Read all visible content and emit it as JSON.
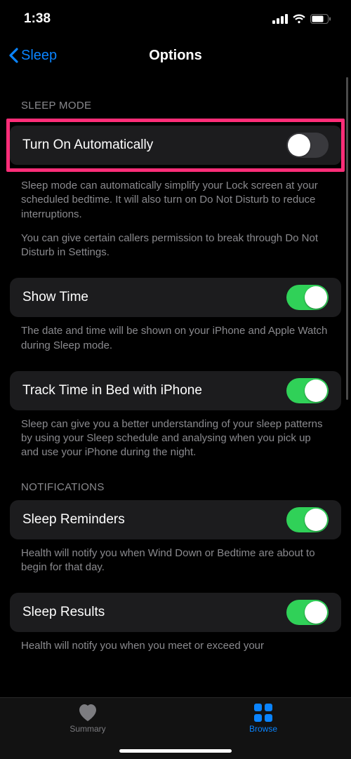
{
  "status": {
    "time": "1:38"
  },
  "nav": {
    "back": "Sleep",
    "title": "Options"
  },
  "sections": {
    "sleep_mode": {
      "header": "SLEEP MODE",
      "turn_on_auto": {
        "label": "Turn On Automatically",
        "on": false
      },
      "desc1": "Sleep mode can automatically simplify your Lock screen at your scheduled bedtime. It will also turn on Do Not Disturb to reduce interruptions.",
      "desc2": "You can give certain callers permission to break through Do Not Disturb in Settings.",
      "show_time": {
        "label": "Show Time",
        "on": true
      },
      "show_time_desc": "The date and time will be shown on your iPhone and Apple Watch during Sleep mode.",
      "track": {
        "label": "Track Time in Bed with iPhone",
        "on": true
      },
      "track_desc": "Sleep can give you a better understanding of your sleep patterns by using your Sleep schedule and analysing when you pick up and use your iPhone during the night."
    },
    "notifications": {
      "header": "NOTIFICATIONS",
      "reminders": {
        "label": "Sleep Reminders",
        "on": true
      },
      "reminders_desc": "Health will notify you when Wind Down or Bedtime are about to begin for that day.",
      "results": {
        "label": "Sleep Results",
        "on": true
      },
      "results_desc": "Health will notify you when you meet or exceed your"
    }
  },
  "tabs": {
    "summary": "Summary",
    "browse": "Browse"
  }
}
